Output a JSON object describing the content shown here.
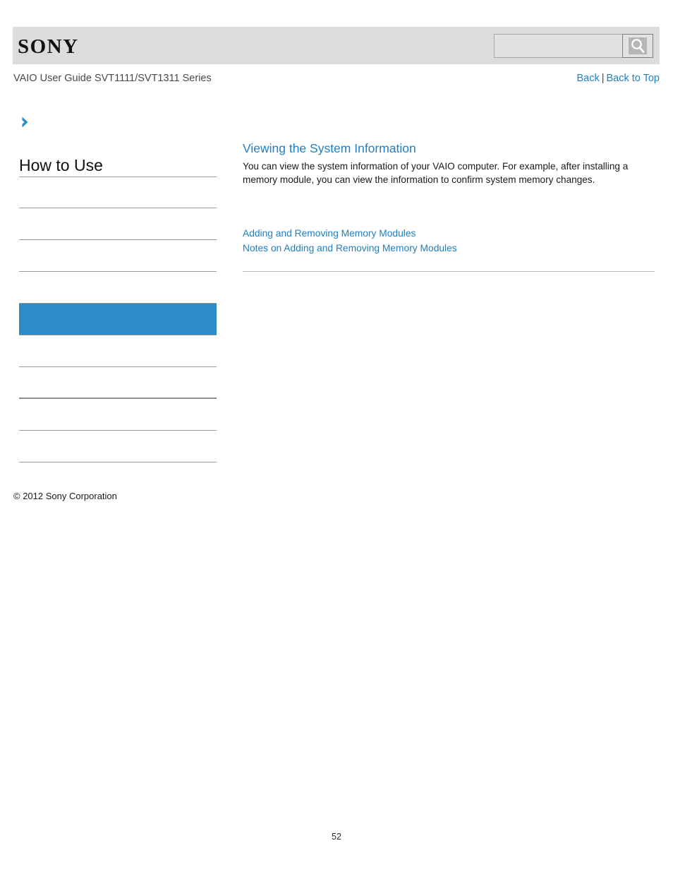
{
  "header": {
    "brand": "SONY",
    "search": {
      "value": "",
      "placeholder": "",
      "icon": "search-icon"
    }
  },
  "subheader": {
    "guide_title": "VAIO User Guide SVT1111/SVT1311 Series",
    "nav": {
      "back": "Back",
      "separator": "|",
      "back_to_top": "Back to Top"
    }
  },
  "sidebar": {
    "breadcrumb_icon": "chevron-right-icon",
    "title": "How to Use",
    "items": [
      {
        "label": "",
        "active": false
      },
      {
        "label": "",
        "active": false
      },
      {
        "label": "",
        "active": false
      },
      {
        "label": "",
        "active": false
      },
      {
        "label": "",
        "active": true
      },
      {
        "label": "",
        "active": false
      },
      {
        "label": "",
        "active": false
      },
      {
        "label": "",
        "active": false
      },
      {
        "label": "",
        "active": false
      }
    ],
    "copyright": "© 2012 Sony Corporation"
  },
  "main": {
    "heading": "Viewing the System Information",
    "body": "You can view the system information of your VAIO computer. For example, after installing a memory module, you can view the information to confirm system memory changes.",
    "related_links": [
      "Adding and Removing Memory Modules",
      "Notes on Adding and Removing Memory Modules"
    ]
  },
  "footer": {
    "page_number": "52"
  },
  "colors": {
    "accent_blue": "#2e8bc9",
    "link_blue": "#1f7fc4",
    "header_gray": "#dcdcdc",
    "rule_gray": "#9a9a9a"
  }
}
